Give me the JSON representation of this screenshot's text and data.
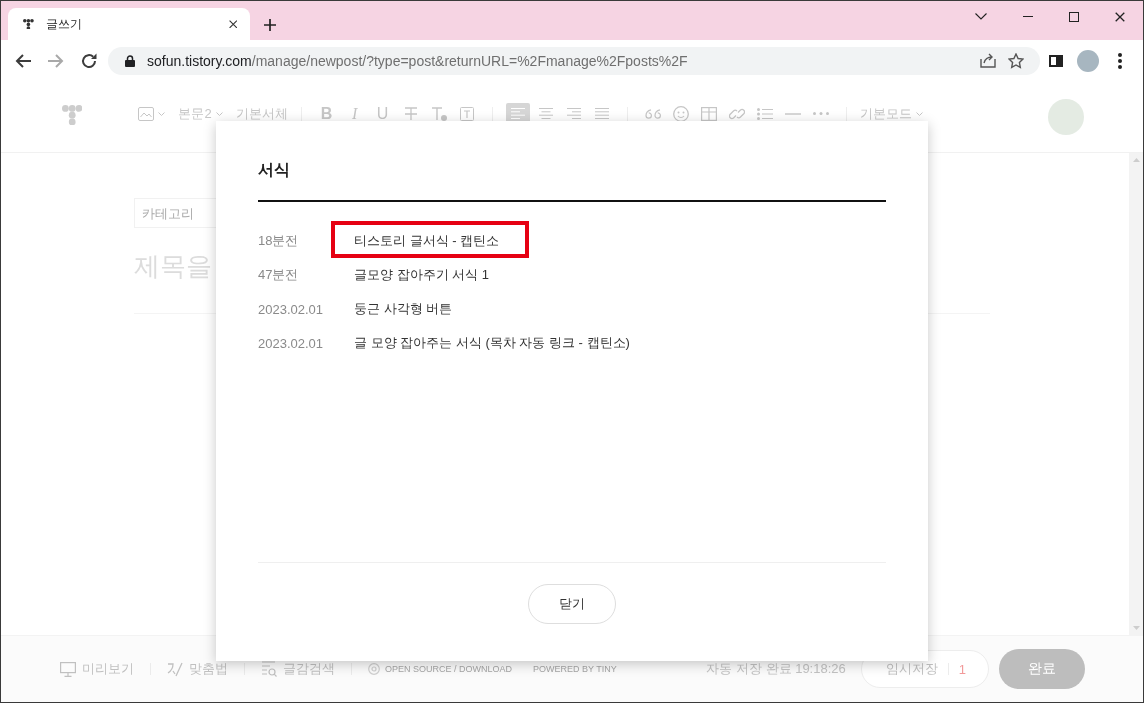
{
  "browser": {
    "tab": {
      "title": "글쓰기"
    },
    "nav_buttons": [
      {
        "kind": "back",
        "disabled": false
      },
      {
        "kind": "forward",
        "disabled": true
      },
      {
        "kind": "reload",
        "disabled": false
      }
    ],
    "address": {
      "domain": "sofun.tistory.com",
      "path": "/manage/newpost/?type=post&returnURL=%2Fmanage%2Fposts%2F"
    }
  },
  "editor_toolbar": {
    "tool_groups": [
      [
        {
          "kind": "image"
        },
        {
          "kind": "dropdown",
          "label": "본문2"
        },
        {
          "kind": "font",
          "label": "기본서체"
        }
      ],
      [
        {
          "kind": "bold",
          "label": "B"
        },
        {
          "kind": "italic",
          "label": "I"
        },
        {
          "kind": "underline",
          "label": "U"
        },
        {
          "kind": "strikethrough"
        },
        {
          "kind": "text-color"
        },
        {
          "kind": "text-background"
        }
      ],
      [
        {
          "kind": "align-left",
          "selected": true
        },
        {
          "kind": "align-center",
          "selected": false
        },
        {
          "kind": "align-right",
          "selected": false
        },
        {
          "kind": "align-justify",
          "selected": false
        }
      ],
      [
        {
          "kind": "quote"
        },
        {
          "kind": "emoji"
        },
        {
          "kind": "table"
        },
        {
          "kind": "link"
        },
        {
          "kind": "list"
        },
        {
          "kind": "divider"
        },
        {
          "kind": "more"
        }
      ],
      [
        {
          "kind": "dropdown",
          "label": "기본모드"
        }
      ]
    ]
  },
  "editor": {
    "category": {
      "placeholder": "카테고리"
    },
    "title": {
      "placeholder": "제목을"
    }
  },
  "footer": {
    "tools": [
      {
        "kind": "preview",
        "label": "미리보기"
      },
      {
        "kind": "spellcheck",
        "label": "맞춤법"
      },
      {
        "kind": "material-search",
        "label": "글감검색"
      }
    ],
    "credits": [
      "OPEN SOURCE / DOWNLOAD",
      "POWERED BY TINY"
    ],
    "autosave": "자동 저장 완료 19:18:26",
    "draft_button": {
      "label": "임시저장",
      "count": "1"
    },
    "publish_button": "완료"
  },
  "dialog": {
    "title": "서식",
    "templates": [
      {
        "time": "18분전",
        "name": "티스토리 글서식 - 캡틴소",
        "highlighted": true
      },
      {
        "time": "47분전",
        "name": "글모양 잡아주기 서식 1",
        "highlighted": false
      },
      {
        "time": "2023.02.01",
        "name": "둥근 사각형 버튼",
        "highlighted": false
      },
      {
        "time": "2023.02.01",
        "name": "글 모양 잡아주는 서식 (목차 자동 링크 - 캡틴소)",
        "highlighted": false
      }
    ],
    "close_button": "닫기"
  }
}
